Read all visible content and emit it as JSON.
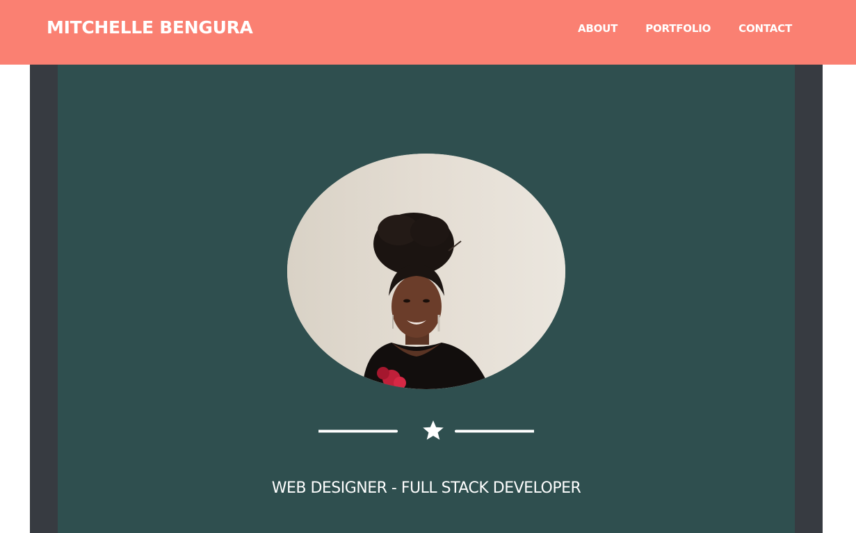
{
  "header": {
    "brand": "MITCHELLE BENGURA",
    "nav": [
      {
        "label": "ABOUT"
      },
      {
        "label": "PORTFOLIO"
      },
      {
        "label": "CONTACT"
      }
    ]
  },
  "hero": {
    "subtitle": "WEB DESIGNER - FULL STACK DEVELOPER",
    "divider_icon": "star-icon"
  },
  "colors": {
    "navbar": "#fa8072",
    "hero_bg": "#2f4f4f",
    "hero_border": "#373b41",
    "text": "#ffffff"
  }
}
